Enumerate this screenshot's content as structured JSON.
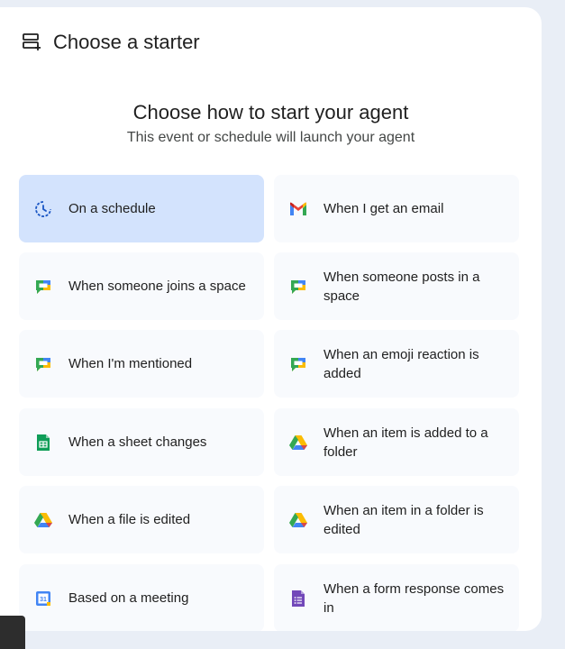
{
  "header": {
    "title": "Choose a starter",
    "icon": "add-list-icon"
  },
  "main": {
    "heading": "Choose how to start your agent",
    "subheading": "This event or schedule will launch your agent"
  },
  "starters": [
    {
      "label": "On a schedule",
      "icon": "schedule-icon",
      "selected": true
    },
    {
      "label": "When I get an email",
      "icon": "gmail-icon",
      "selected": false
    },
    {
      "label": "When someone joins a space",
      "icon": "google-chat-icon",
      "selected": false
    },
    {
      "label": "When someone posts in a space",
      "icon": "google-chat-icon",
      "selected": false
    },
    {
      "label": "When I'm mentioned",
      "icon": "google-chat-icon",
      "selected": false
    },
    {
      "label": "When an emoji reaction is added",
      "icon": "google-chat-icon",
      "selected": false
    },
    {
      "label": "When a sheet changes",
      "icon": "google-sheets-icon",
      "selected": false
    },
    {
      "label": "When an item is added to a folder",
      "icon": "google-drive-icon",
      "selected": false
    },
    {
      "label": "When a file is edited",
      "icon": "google-drive-icon",
      "selected": false
    },
    {
      "label": "When an item in a folder is edited",
      "icon": "google-drive-icon",
      "selected": false
    },
    {
      "label": "Based on a meeting",
      "icon": "google-calendar-icon",
      "selected": false
    },
    {
      "label": "When a form response comes in",
      "icon": "google-forms-icon",
      "selected": false
    }
  ],
  "colors": {
    "selected_card": "#d3e3fd",
    "card": "#f8fafd",
    "page_background": "#e9eef6"
  }
}
